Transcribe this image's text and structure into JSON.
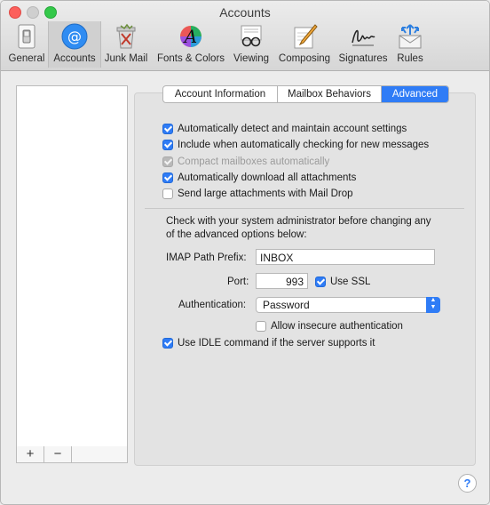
{
  "window": {
    "title": "Accounts"
  },
  "toolbar": {
    "tabs": [
      {
        "label": "General",
        "icon": "general-switch-icon"
      },
      {
        "label": "Accounts",
        "icon": "at-sign-icon"
      },
      {
        "label": "Junk Mail",
        "icon": "junk-trash-icon"
      },
      {
        "label": "Fonts & Colors",
        "icon": "fonts-colors-icon"
      },
      {
        "label": "Viewing",
        "icon": "glasses-icon"
      },
      {
        "label": "Composing",
        "icon": "pencil-paper-icon"
      },
      {
        "label": "Signatures",
        "icon": "signature-icon"
      },
      {
        "label": "Rules",
        "icon": "rules-envelope-icon"
      }
    ],
    "selected": "Accounts"
  },
  "sidebar": {
    "add_label": "+",
    "remove_label": "−"
  },
  "segments": {
    "items": [
      "Account Information",
      "Mailbox Behaviors",
      "Advanced"
    ],
    "selected": "Advanced"
  },
  "options": {
    "auto_detect": {
      "label": "Automatically detect and maintain account settings",
      "checked": true
    },
    "include_check": {
      "label": "Include when automatically checking for new messages",
      "checked": true
    },
    "compact": {
      "label": "Compact mailboxes automatically",
      "checked": true,
      "disabled": true
    },
    "auto_download": {
      "label": "Automatically download all attachments",
      "checked": true
    },
    "mail_drop": {
      "label": "Send large attachments with Mail Drop",
      "checked": false
    }
  },
  "advanced": {
    "note_line1": "Check with your system administrator before changing any",
    "note_line2": "of the advanced options below:",
    "imap_prefix_label": "IMAP Path Prefix:",
    "imap_prefix_value": "INBOX",
    "port_label": "Port:",
    "port_value": "993",
    "use_ssl": {
      "label": "Use SSL",
      "checked": true
    },
    "auth_label": "Authentication:",
    "auth_value": "Password",
    "allow_insecure": {
      "label": "Allow insecure authentication",
      "checked": false
    },
    "idle": {
      "label": "Use IDLE command if the server supports it",
      "checked": true
    }
  },
  "help_label": "?",
  "colors": {
    "accent": "#2f7cf6"
  }
}
